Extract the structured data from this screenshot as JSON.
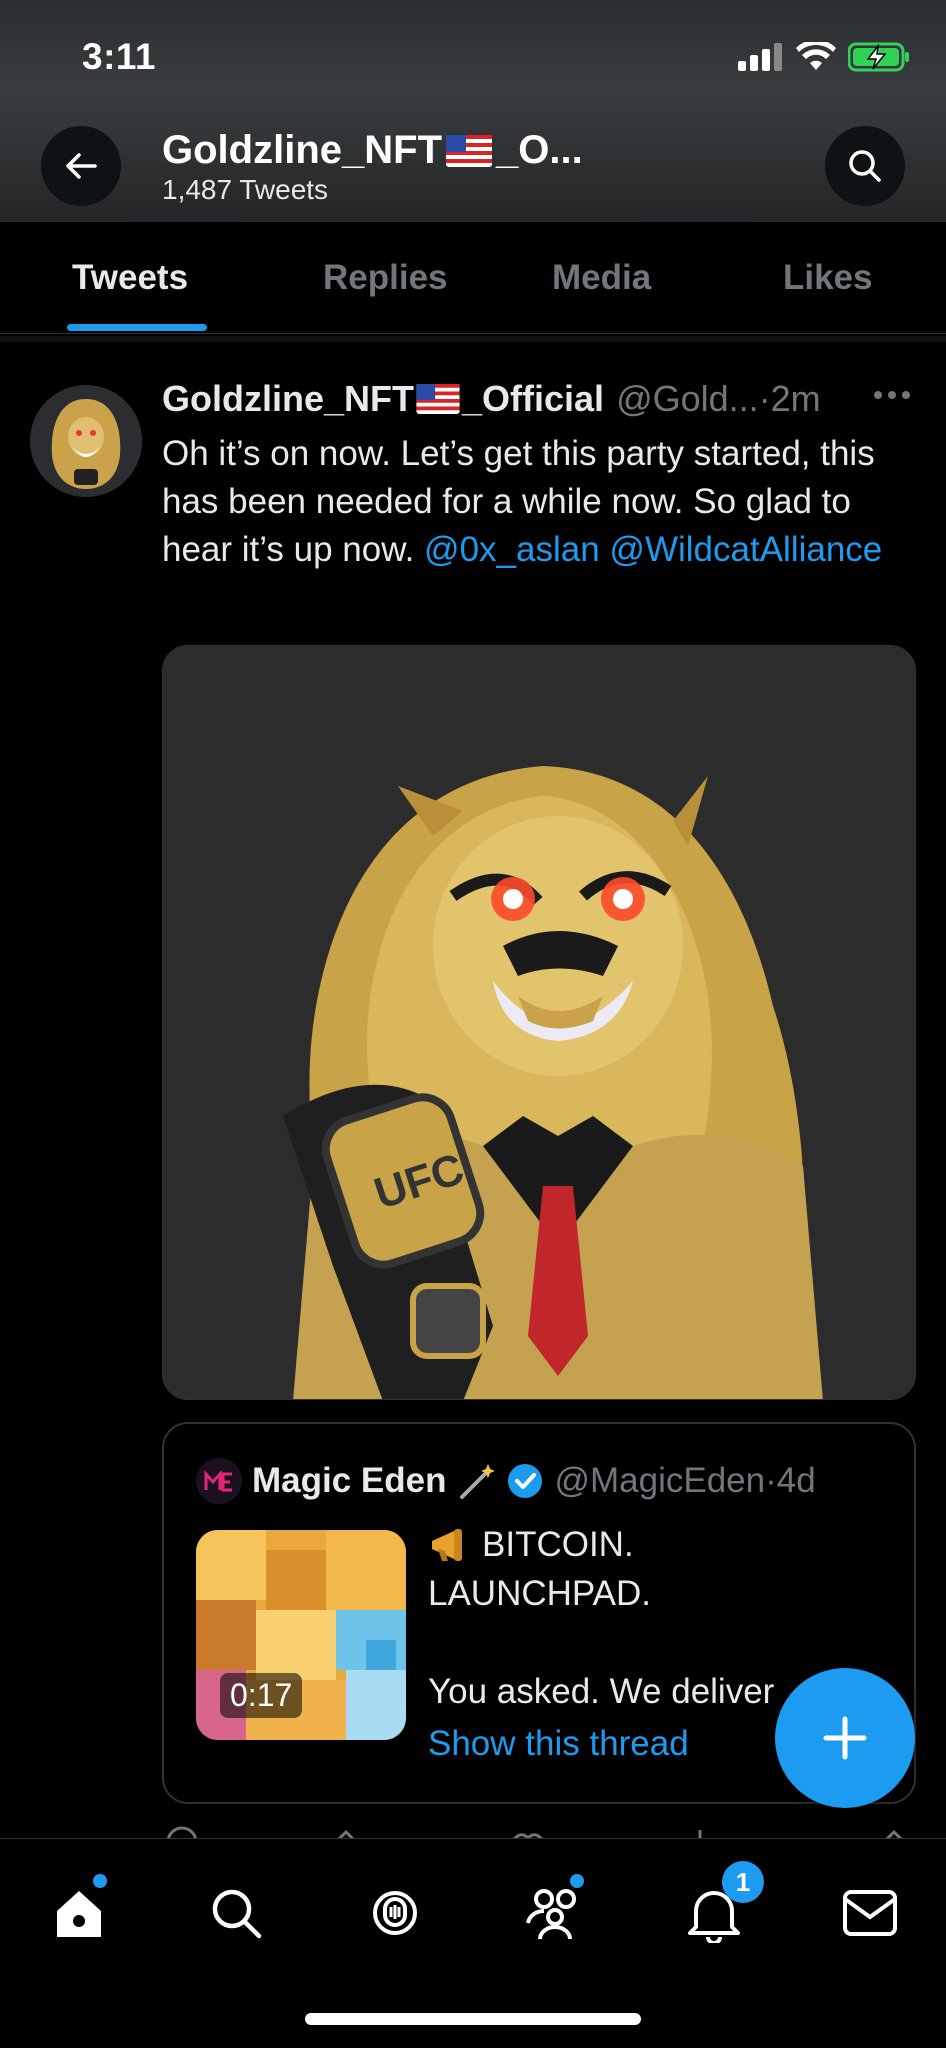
{
  "status_bar": {
    "time": "3:11"
  },
  "header": {
    "title": "Goldzline_NFT",
    "title_suffix": "_O...",
    "subtitle": "1,487 Tweets"
  },
  "tabs": [
    {
      "label": "Tweets",
      "active": true
    },
    {
      "label": "Replies",
      "active": false
    },
    {
      "label": "Media",
      "active": false
    },
    {
      "label": "Likes",
      "active": false
    }
  ],
  "tweet": {
    "name_part1": "Goldzline_NFT",
    "name_part2": "_Official",
    "handle": "@Gold...",
    "time": "·2m",
    "text": "Oh it’s on now. Let’s get this party started, this has been needed for a while now. So glad to hear it’s up now.",
    "mention1": "@0x_aslan",
    "mention2": "@WildcatAlliance"
  },
  "quote": {
    "name": "Magic Eden",
    "handle": "@MagicEden",
    "time": "·4d",
    "line1": "BITCOIN.",
    "line2": "LAUNCHPAD.",
    "line3": "You asked. We deliver",
    "duration": "0:17",
    "show_thread": "Show this thread"
  },
  "notifications": {
    "badge": "1"
  },
  "colors": {
    "accent": "#1d9bf0",
    "background": "#000000",
    "muted": "#71767b"
  }
}
